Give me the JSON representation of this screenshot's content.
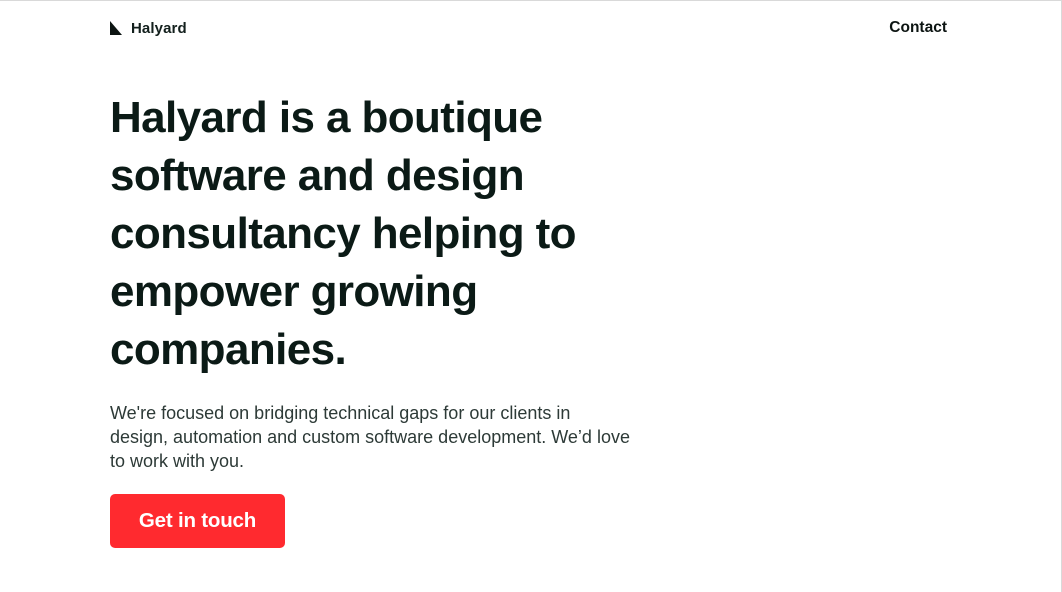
{
  "header": {
    "brand_name": "Halyard",
    "brand_icon": "halyard-logo-icon",
    "contact_label": "Contact"
  },
  "hero": {
    "title": "Halyard is a boutique software and design consultancy helping to empower growing companies.",
    "description": "We're focused on bridging technical gaps for our clients in design, automation and custom software development. We’d love to work with you.",
    "cta_label": "Get in touch"
  },
  "colors": {
    "accent": "#ff2a2f",
    "text": "#0b1a16",
    "body_text": "#2d3a37",
    "background": "#ffffff"
  }
}
